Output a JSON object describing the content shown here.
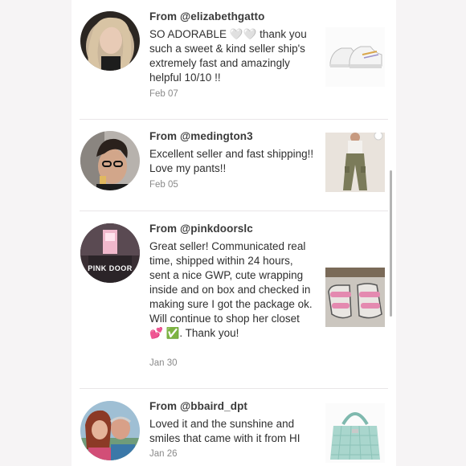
{
  "reviews": [
    {
      "from": "From @elizabethgatto",
      "text": "SO ADORABLE 🤍🤍 thank you such a sweet & kind seller ship's extremely fast and amazingly helpful 10/10 !!",
      "date": "Feb 07",
      "product": "white-sneakers"
    },
    {
      "from": "From @medington3",
      "text": "Excellent seller and fast shipping!! Love my pants!!",
      "date": "Feb 05",
      "product": "cargo-pants"
    },
    {
      "from": "From @pinkdoorslc",
      "text": "Great seller! Communicated real time, shipped within 24 hours, sent a nice GWP, cute wrapping inside and on box and checked in making sure I got the package ok. Will continue to shop her closet 💕 ✅. Thank you!",
      "date": "Jan 30",
      "product": "pink-sandals",
      "avatar_text": "PINK DOOR"
    },
    {
      "from": "From @bbaird_dpt",
      "text": "Loved it and the sunshine and smiles that came with it from HI",
      "date": "Jan 26",
      "product": "mint-handbag"
    }
  ],
  "colors": {
    "background": "#f6f4f5",
    "panel": "#ffffff",
    "text": "#2f2f2f",
    "muted": "#8a8a8a"
  }
}
